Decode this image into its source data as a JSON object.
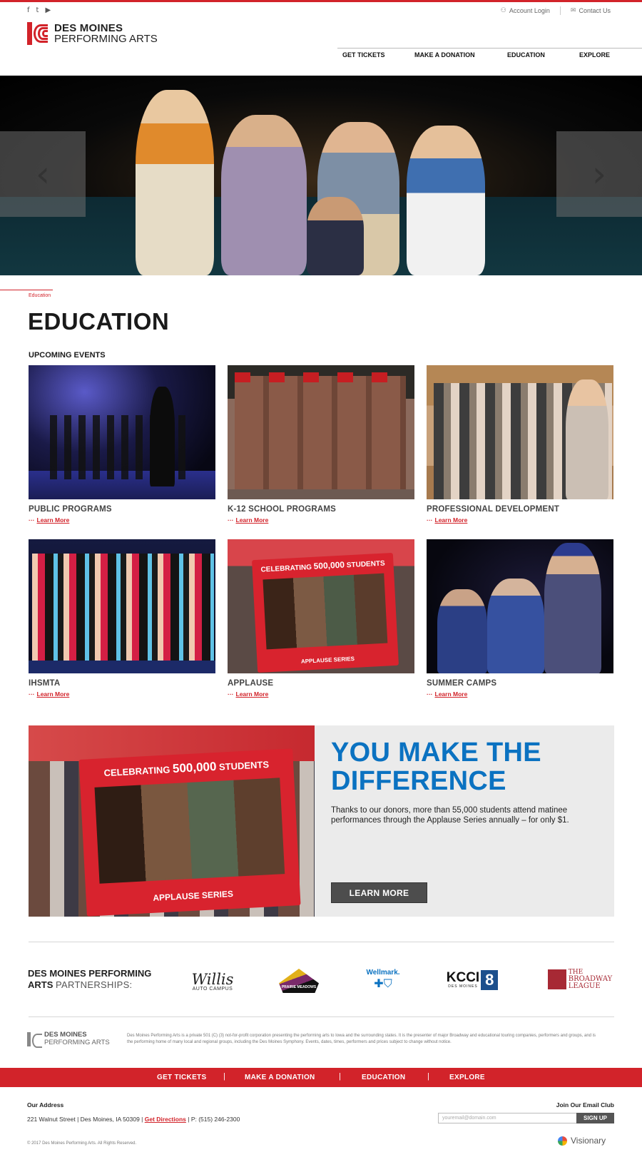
{
  "header": {
    "social": [
      "f",
      "t",
      "▶"
    ],
    "account_login": "Account Login",
    "contact_us": "Contact Us",
    "logo_line1": "DES MOINES",
    "logo_line2": "PERFORMING ARTS",
    "nav": [
      "GET TICKETS",
      "MAKE A DONATION",
      "EDUCATION",
      "EXPLORE"
    ]
  },
  "hero": {
    "prev_arrow": "‹",
    "next_arrow": "›"
  },
  "breadcrumb": "Education",
  "page_title": "EDUCATION",
  "section_title": "UPCOMING EVENTS",
  "learn_more": "Learn More",
  "cards": [
    {
      "title": "PUBLIC PROGRAMS"
    },
    {
      "title": "K-12 SCHOOL PROGRAMS"
    },
    {
      "title": "PROFESSIONAL DEVELOPMENT"
    },
    {
      "title": "IHSMTA"
    },
    {
      "title": "APPLAUSE"
    },
    {
      "title": "SUMMER CAMPS"
    }
  ],
  "applause_frame": {
    "line1": "CELEBRATING",
    "line1_bold": "500,000",
    "line1_end": "STUDENTS",
    "bottom": "APPLAUSE SERIES"
  },
  "cta": {
    "heading_line1": "YOU MAKE THE",
    "heading_line2": "DIFFERENCE",
    "body": "Thanks to our donors, more than 55,000 students attend matinee performances through the Applause Series annually – for only $1.",
    "button": "LEARN MORE"
  },
  "partnerships": {
    "label_bold1": "DES MOINES PERFORMING",
    "label_bold2": "ARTS",
    "label_light": "PARTNERSHIPS:",
    "logos": {
      "willis_line1": "Willis",
      "willis_line2": "AUTO CAMPUS",
      "prairie": "PRAIRIE MEADOWS",
      "wellmark": "Wellmark.",
      "kcci": "KCCI",
      "kcci_sub": "DES MOINES",
      "kcci_num": "8",
      "broadway_line1": "THE",
      "broadway_line2": "BROADWAY",
      "broadway_line3": "LEAGUE"
    }
  },
  "footer": {
    "logo_line1": "DES MOINES",
    "logo_line2": "PERFORMING ARTS",
    "description": "Des Moines Performing Arts is a private 501 (C) (3) not-for-profit corporation presenting the performing arts to Iowa and the surrounding states. It is the presenter of major Broadway and educational touring companies, performers and groups, and is the performing home of many local and regional groups, including the Des Moines Symphony. Events, dates, times, performers and prices subject to change without notice.",
    "nav": [
      "GET TICKETS",
      "MAKE A DONATION",
      "EDUCATION",
      "EXPLORE"
    ],
    "pipe": "|",
    "address_heading": "Our Address",
    "address": "221 Walnut Street | Des Moines, IA 50309 |",
    "directions": "Get Directions",
    "phone": "| P: (515) 246-2300",
    "copyright": "© 2017 Des Moines Performing Arts. All Rights Reserved.",
    "email_club": "Join Our Email Club",
    "email_placeholder": "youremail@domain.com",
    "signup": "SIGN UP",
    "credit": "Visionary"
  },
  "colors": {
    "brand_red": "#d2232a",
    "cta_blue": "#0b72c1"
  }
}
